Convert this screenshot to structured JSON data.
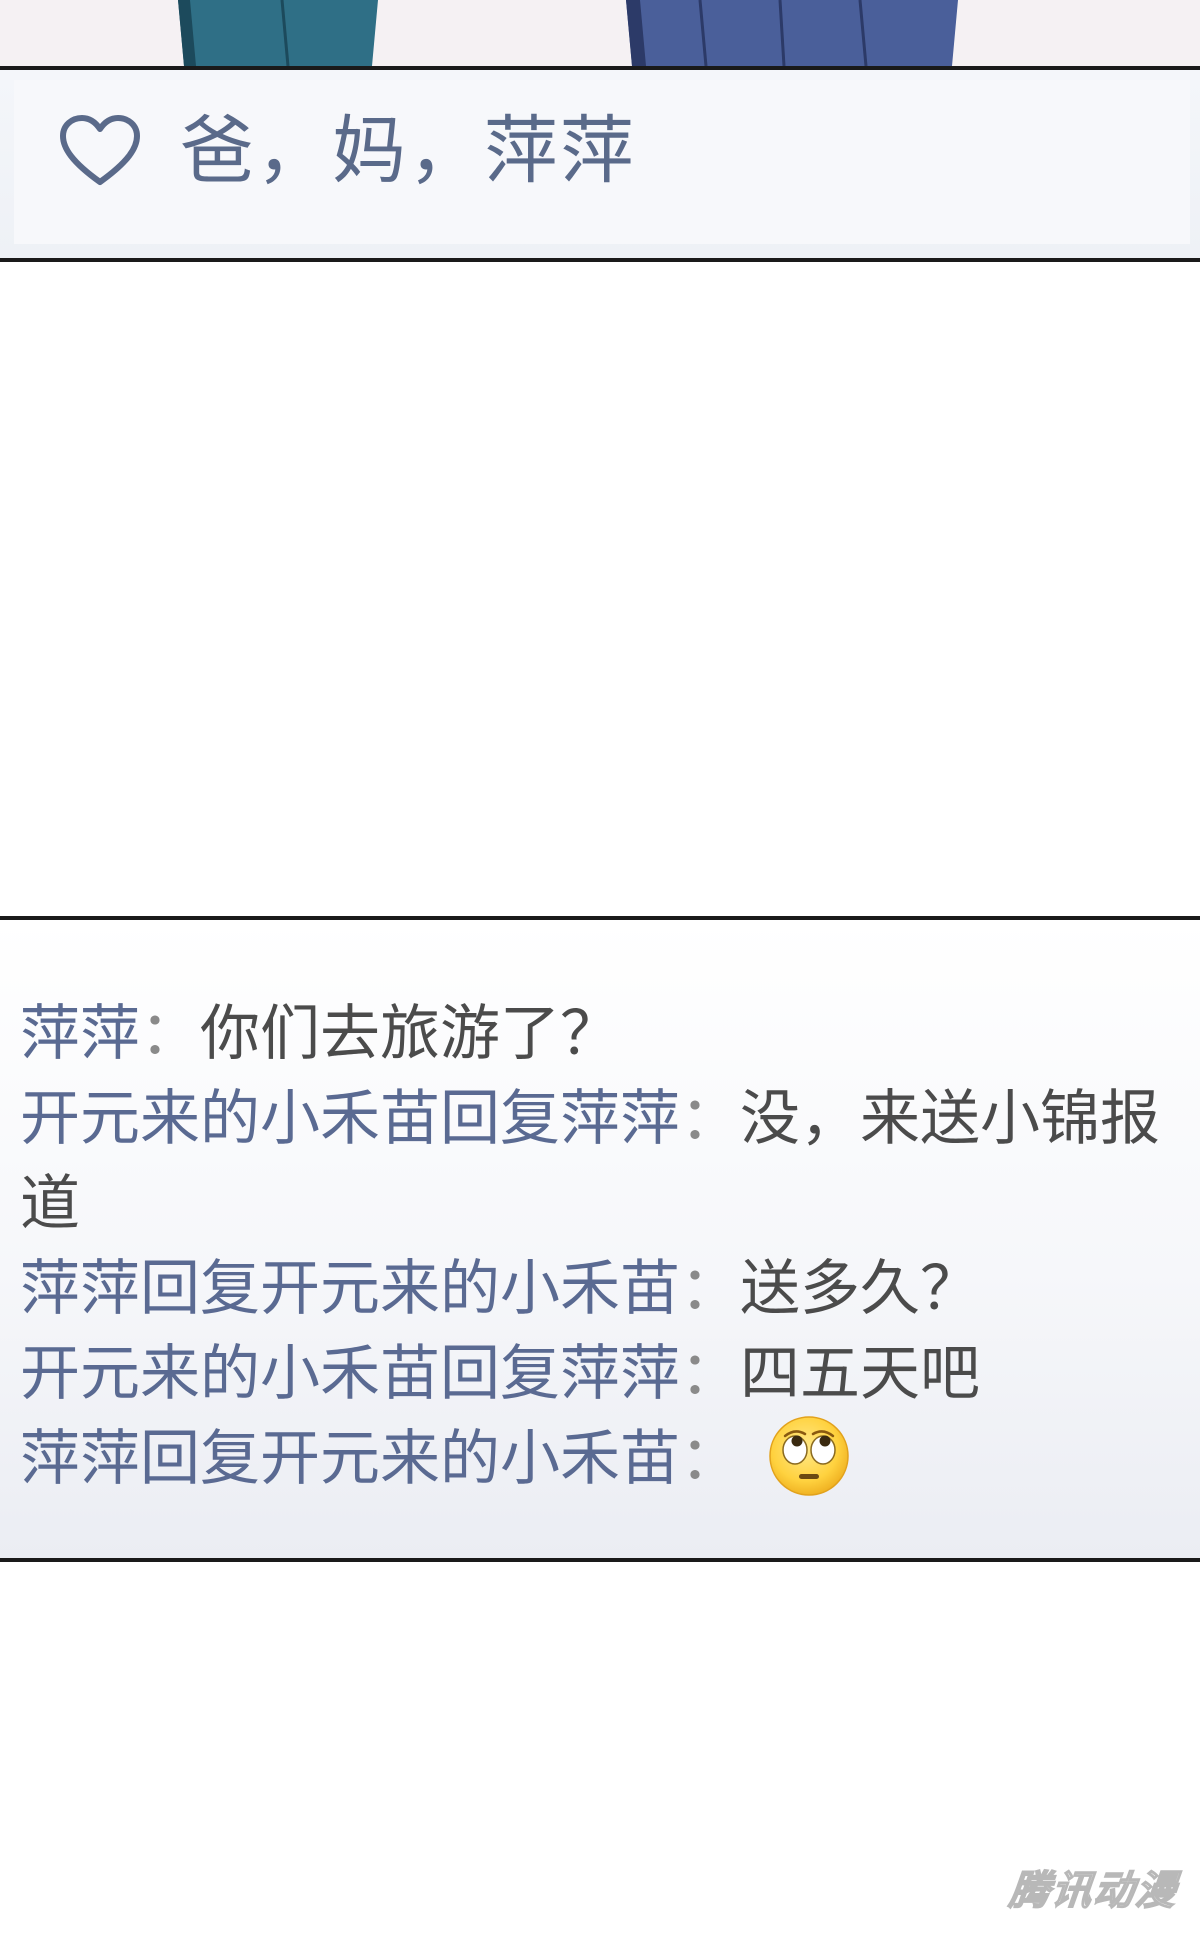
{
  "likes": {
    "icon": "heart-outline-icon",
    "names": "爸，妈，萍萍"
  },
  "comments": [
    {
      "author": "萍萍",
      "separator": "：",
      "text": "你们去旅游了？"
    },
    {
      "author": "开元来的小禾苗回复萍萍",
      "separator": "：",
      "text": "没，来送小锦报道"
    },
    {
      "author": "萍萍回复开元来的小禾苗",
      "separator": "：",
      "text": "送多久？"
    },
    {
      "author": "开元来的小禾苗回复萍萍",
      "separator": "：",
      "text": "四五天吧"
    },
    {
      "author": "萍萍回复开元来的小禾苗",
      "separator": "：",
      "text": "",
      "emoji": "eye-roll-emoji"
    }
  ],
  "watermark": "腾讯动漫",
  "colors": {
    "name_text": "#5a6a92",
    "body_text": "#4b4b4b",
    "likes_text": "#5a6a8a",
    "border": "#1a1a1a"
  }
}
